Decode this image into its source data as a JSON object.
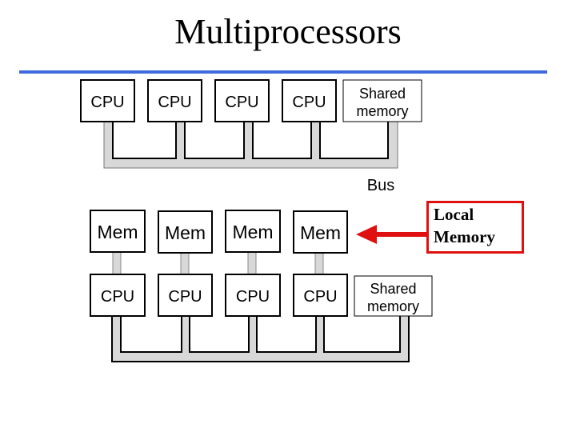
{
  "title": "Multiprocessors",
  "accent_rule_color": "#3f6be0",
  "callout_color": "#e01010",
  "bus_fill_color": "#d8d8d8",
  "top_diagram": {
    "units": [
      "CPU",
      "CPU",
      "CPU",
      "CPU"
    ],
    "shared_memory": [
      "Shared",
      "memory"
    ],
    "bus_label": "Bus"
  },
  "bottom_diagram": {
    "local_memories": [
      "Mem",
      "Mem",
      "Mem",
      "Mem"
    ],
    "units": [
      "CPU",
      "CPU",
      "CPU",
      "CPU"
    ],
    "shared_memory": [
      "Shared",
      "memory"
    ]
  },
  "callout": {
    "line1": "Local",
    "line2": "Memory"
  }
}
